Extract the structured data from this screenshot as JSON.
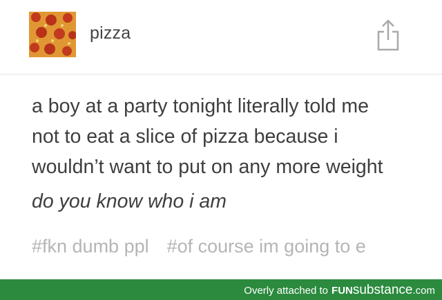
{
  "post": {
    "blog_name": "pizza",
    "avatar_icon": "pizza-avatar-icon",
    "share_icon": "share-icon",
    "body_lines": [
      "a boy at a party tonight literally told me",
      "not to eat a slice of pizza because i",
      "wouldn’t want to put on any more weight"
    ],
    "italic_line": "do you know who i am",
    "tags": [
      "#fkn dumb ppl",
      "#of course im going to e"
    ]
  },
  "footer": {
    "caption": "Overly attached to",
    "brand_part1": "FUN",
    "brand_part2": "substance",
    "brand_part3": ".com",
    "background_color": "#2b8a3e"
  }
}
